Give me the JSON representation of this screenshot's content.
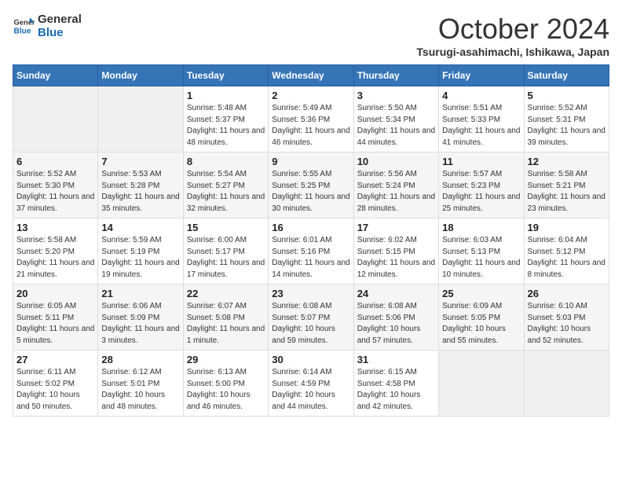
{
  "logo": {
    "line1": "General",
    "line2": "Blue"
  },
  "title": "October 2024",
  "location": "Tsurugi-asahimachi, Ishikawa, Japan",
  "headers": [
    "Sunday",
    "Monday",
    "Tuesday",
    "Wednesday",
    "Thursday",
    "Friday",
    "Saturday"
  ],
  "weeks": [
    [
      {
        "day": "",
        "info": ""
      },
      {
        "day": "",
        "info": ""
      },
      {
        "day": "1",
        "info": "Sunrise: 5:48 AM\nSunset: 5:37 PM\nDaylight: 11 hours and 48 minutes."
      },
      {
        "day": "2",
        "info": "Sunrise: 5:49 AM\nSunset: 5:36 PM\nDaylight: 11 hours and 46 minutes."
      },
      {
        "day": "3",
        "info": "Sunrise: 5:50 AM\nSunset: 5:34 PM\nDaylight: 11 hours and 44 minutes."
      },
      {
        "day": "4",
        "info": "Sunrise: 5:51 AM\nSunset: 5:33 PM\nDaylight: 11 hours and 41 minutes."
      },
      {
        "day": "5",
        "info": "Sunrise: 5:52 AM\nSunset: 5:31 PM\nDaylight: 11 hours and 39 minutes."
      }
    ],
    [
      {
        "day": "6",
        "info": "Sunrise: 5:52 AM\nSunset: 5:30 PM\nDaylight: 11 hours and 37 minutes."
      },
      {
        "day": "7",
        "info": "Sunrise: 5:53 AM\nSunset: 5:28 PM\nDaylight: 11 hours and 35 minutes."
      },
      {
        "day": "8",
        "info": "Sunrise: 5:54 AM\nSunset: 5:27 PM\nDaylight: 11 hours and 32 minutes."
      },
      {
        "day": "9",
        "info": "Sunrise: 5:55 AM\nSunset: 5:25 PM\nDaylight: 11 hours and 30 minutes."
      },
      {
        "day": "10",
        "info": "Sunrise: 5:56 AM\nSunset: 5:24 PM\nDaylight: 11 hours and 28 minutes."
      },
      {
        "day": "11",
        "info": "Sunrise: 5:57 AM\nSunset: 5:23 PM\nDaylight: 11 hours and 25 minutes."
      },
      {
        "day": "12",
        "info": "Sunrise: 5:58 AM\nSunset: 5:21 PM\nDaylight: 11 hours and 23 minutes."
      }
    ],
    [
      {
        "day": "13",
        "info": "Sunrise: 5:58 AM\nSunset: 5:20 PM\nDaylight: 11 hours and 21 minutes."
      },
      {
        "day": "14",
        "info": "Sunrise: 5:59 AM\nSunset: 5:19 PM\nDaylight: 11 hours and 19 minutes."
      },
      {
        "day": "15",
        "info": "Sunrise: 6:00 AM\nSunset: 5:17 PM\nDaylight: 11 hours and 17 minutes."
      },
      {
        "day": "16",
        "info": "Sunrise: 6:01 AM\nSunset: 5:16 PM\nDaylight: 11 hours and 14 minutes."
      },
      {
        "day": "17",
        "info": "Sunrise: 6:02 AM\nSunset: 5:15 PM\nDaylight: 11 hours and 12 minutes."
      },
      {
        "day": "18",
        "info": "Sunrise: 6:03 AM\nSunset: 5:13 PM\nDaylight: 11 hours and 10 minutes."
      },
      {
        "day": "19",
        "info": "Sunrise: 6:04 AM\nSunset: 5:12 PM\nDaylight: 11 hours and 8 minutes."
      }
    ],
    [
      {
        "day": "20",
        "info": "Sunrise: 6:05 AM\nSunset: 5:11 PM\nDaylight: 11 hours and 5 minutes."
      },
      {
        "day": "21",
        "info": "Sunrise: 6:06 AM\nSunset: 5:09 PM\nDaylight: 11 hours and 3 minutes."
      },
      {
        "day": "22",
        "info": "Sunrise: 6:07 AM\nSunset: 5:08 PM\nDaylight: 11 hours and 1 minute."
      },
      {
        "day": "23",
        "info": "Sunrise: 6:08 AM\nSunset: 5:07 PM\nDaylight: 10 hours and 59 minutes."
      },
      {
        "day": "24",
        "info": "Sunrise: 6:08 AM\nSunset: 5:06 PM\nDaylight: 10 hours and 57 minutes."
      },
      {
        "day": "25",
        "info": "Sunrise: 6:09 AM\nSunset: 5:05 PM\nDaylight: 10 hours and 55 minutes."
      },
      {
        "day": "26",
        "info": "Sunrise: 6:10 AM\nSunset: 5:03 PM\nDaylight: 10 hours and 52 minutes."
      }
    ],
    [
      {
        "day": "27",
        "info": "Sunrise: 6:11 AM\nSunset: 5:02 PM\nDaylight: 10 hours and 50 minutes."
      },
      {
        "day": "28",
        "info": "Sunrise: 6:12 AM\nSunset: 5:01 PM\nDaylight: 10 hours and 48 minutes."
      },
      {
        "day": "29",
        "info": "Sunrise: 6:13 AM\nSunset: 5:00 PM\nDaylight: 10 hours and 46 minutes."
      },
      {
        "day": "30",
        "info": "Sunrise: 6:14 AM\nSunset: 4:59 PM\nDaylight: 10 hours and 44 minutes."
      },
      {
        "day": "31",
        "info": "Sunrise: 6:15 AM\nSunset: 4:58 PM\nDaylight: 10 hours and 42 minutes."
      },
      {
        "day": "",
        "info": ""
      },
      {
        "day": "",
        "info": ""
      }
    ]
  ]
}
